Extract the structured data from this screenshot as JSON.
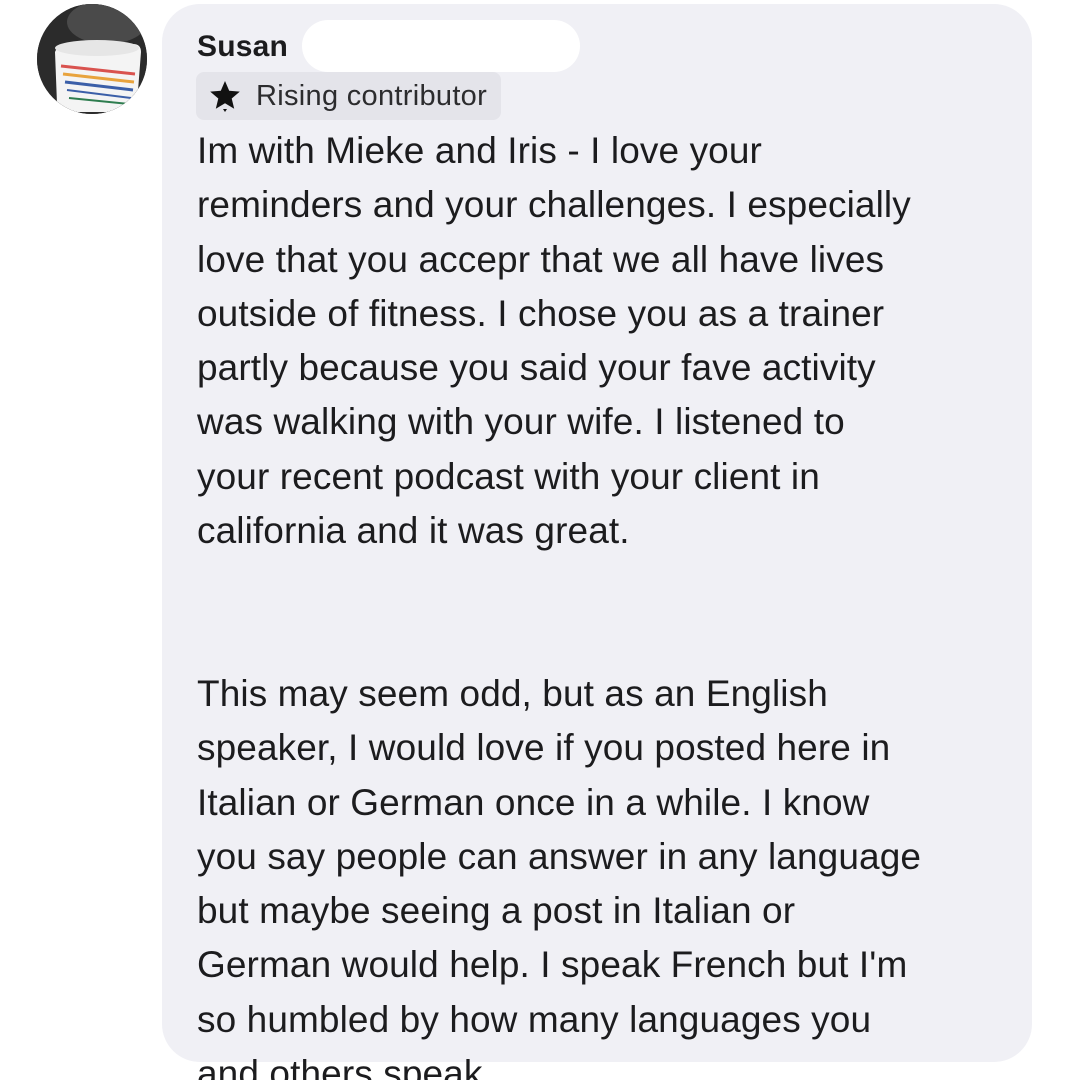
{
  "comment": {
    "author": {
      "name": "Susan",
      "avatar_icon": "profile-photo-mug"
    },
    "badge": {
      "icon": "star-icon",
      "label": "Rising contributor"
    },
    "paragraph_1": [
      "Im with Mieke and Iris - I love your",
      "reminders and your challenges. I especially",
      "love that you accepr that we all have lives",
      "outside of fitness. I chose you as a trainer",
      "partly because you said your fave activity",
      "was walking with your wife. I listened to",
      "your recent podcast with your client in",
      "california and it was great."
    ],
    "paragraph_2": [
      "This may seem odd, but as an English",
      "speaker, I would love if you posted here in",
      "Italian or German once in a while. I know",
      "you say people can answer in any language",
      "but maybe seeing a post in Italian or",
      "German would help. I speak French but I'm",
      "so humbled by how many languages you",
      "and others speak"
    ]
  },
  "colors": {
    "bubble_background": "#f0f0f5",
    "badge_background": "#e4e4ea",
    "text": "#1c1c1e",
    "redaction": "#ffffff"
  }
}
